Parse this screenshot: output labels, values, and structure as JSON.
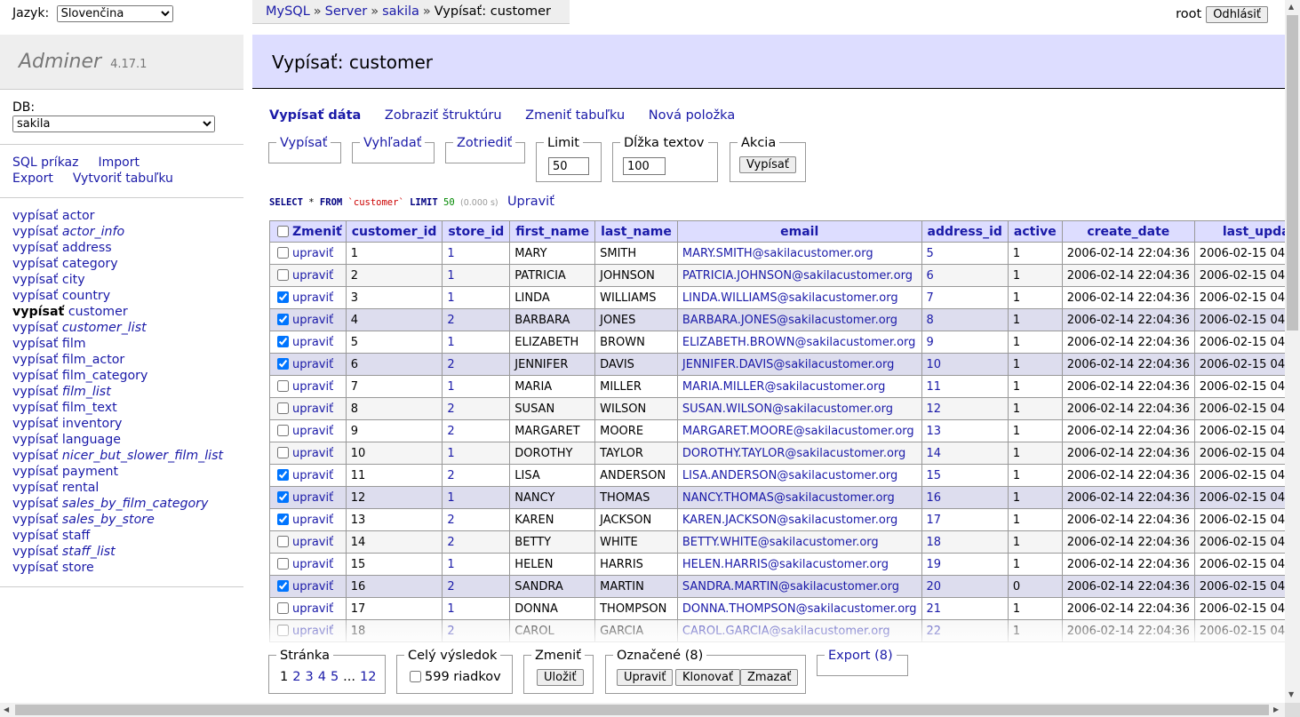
{
  "language": {
    "label": "Jazyk:",
    "value": "Slovenčina"
  },
  "brand": {
    "name": "Adminer",
    "version": "4.17.1"
  },
  "db": {
    "label": "DB:",
    "value": "sakila"
  },
  "links": [
    "SQL príkaz",
    "Import",
    "Export",
    "Vytvoriť tabuľku"
  ],
  "tables": [
    {
      "prefix": "vypísať",
      "name": "actor",
      "italic": false
    },
    {
      "prefix": "vypísať",
      "name": "actor_info",
      "italic": true
    },
    {
      "prefix": "vypísať",
      "name": "address",
      "italic": false
    },
    {
      "prefix": "vypísať",
      "name": "category",
      "italic": false
    },
    {
      "prefix": "vypísať",
      "name": "city",
      "italic": false
    },
    {
      "prefix": "vypísať",
      "name": "country",
      "italic": false
    },
    {
      "prefix": "vypísať",
      "name": "customer",
      "italic": false,
      "current": true
    },
    {
      "prefix": "vypísať",
      "name": "customer_list",
      "italic": true
    },
    {
      "prefix": "vypísať",
      "name": "film",
      "italic": false
    },
    {
      "prefix": "vypísať",
      "name": "film_actor",
      "italic": false
    },
    {
      "prefix": "vypísať",
      "name": "film_category",
      "italic": false
    },
    {
      "prefix": "vypísať",
      "name": "film_list",
      "italic": true
    },
    {
      "prefix": "vypísať",
      "name": "film_text",
      "italic": false
    },
    {
      "prefix": "vypísať",
      "name": "inventory",
      "italic": false
    },
    {
      "prefix": "vypísať",
      "name": "language",
      "italic": false
    },
    {
      "prefix": "vypísať",
      "name": "nicer_but_slower_film_list",
      "italic": true
    },
    {
      "prefix": "vypísať",
      "name": "payment",
      "italic": false
    },
    {
      "prefix": "vypísať",
      "name": "rental",
      "italic": false
    },
    {
      "prefix": "vypísať",
      "name": "sales_by_film_category",
      "italic": true
    },
    {
      "prefix": "vypísať",
      "name": "sales_by_store",
      "italic": true
    },
    {
      "prefix": "vypísať",
      "name": "staff",
      "italic": false
    },
    {
      "prefix": "vypísať",
      "name": "staff_list",
      "italic": true
    },
    {
      "prefix": "vypísať",
      "name": "store",
      "italic": false
    }
  ],
  "breadcrumb": {
    "items": [
      "MySQL",
      "Server",
      "sakila"
    ],
    "sep": "»",
    "current": "Vypísať: customer"
  },
  "user": {
    "name": "root",
    "logout": "Odhlásiť"
  },
  "heading": "Vypísať: customer",
  "tabs": [
    "Vypísať dáta",
    "Zobraziť štruktúru",
    "Zmeniť tabuľku",
    "Nová položka"
  ],
  "controls": {
    "select": "Vypísať",
    "search": "Vyhľadať",
    "sort": "Zotriediť",
    "limit_label": "Limit",
    "limit_value": "50",
    "textlen_label": "Dĺžka textov",
    "textlen_value": "100",
    "action_label": "Akcia",
    "action_button": "Vypísať"
  },
  "query": {
    "select": "SELECT",
    "star": "*",
    "from": "FROM",
    "table": "`customer`",
    "limit": "LIMIT",
    "limit_val": "50",
    "time": "(0.000 s)",
    "edit": "Upraviť"
  },
  "table": {
    "edit_header": "Zmeniť",
    "edit_link": "upraviť",
    "columns": [
      "customer_id",
      "store_id",
      "first_name",
      "last_name",
      "email",
      "address_id",
      "active",
      "create_date",
      "last_upda"
    ],
    "rows": [
      {
        "checked": false,
        "cells": [
          "1",
          "1",
          "MARY",
          "SMITH",
          "MARY.SMITH@sakilacustomer.org",
          "5",
          "1",
          "2006-02-14 22:04:36",
          "2006-02-15 04"
        ]
      },
      {
        "checked": false,
        "cells": [
          "2",
          "1",
          "PATRICIA",
          "JOHNSON",
          "PATRICIA.JOHNSON@sakilacustomer.org",
          "6",
          "1",
          "2006-02-14 22:04:36",
          "2006-02-15 04"
        ]
      },
      {
        "checked": true,
        "cells": [
          "3",
          "1",
          "LINDA",
          "WILLIAMS",
          "LINDA.WILLIAMS@sakilacustomer.org",
          "7",
          "1",
          "2006-02-14 22:04:36",
          "2006-02-15 04"
        ]
      },
      {
        "checked": true,
        "cells": [
          "4",
          "2",
          "BARBARA",
          "JONES",
          "BARBARA.JONES@sakilacustomer.org",
          "8",
          "1",
          "2006-02-14 22:04:36",
          "2006-02-15 04"
        ]
      },
      {
        "checked": true,
        "cells": [
          "5",
          "1",
          "ELIZABETH",
          "BROWN",
          "ELIZABETH.BROWN@sakilacustomer.org",
          "9",
          "1",
          "2006-02-14 22:04:36",
          "2006-02-15 04"
        ]
      },
      {
        "checked": true,
        "cells": [
          "6",
          "2",
          "JENNIFER",
          "DAVIS",
          "JENNIFER.DAVIS@sakilacustomer.org",
          "10",
          "1",
          "2006-02-14 22:04:36",
          "2006-02-15 04"
        ]
      },
      {
        "checked": false,
        "cells": [
          "7",
          "1",
          "MARIA",
          "MILLER",
          "MARIA.MILLER@sakilacustomer.org",
          "11",
          "1",
          "2006-02-14 22:04:36",
          "2006-02-15 04"
        ]
      },
      {
        "checked": false,
        "cells": [
          "8",
          "2",
          "SUSAN",
          "WILSON",
          "SUSAN.WILSON@sakilacustomer.org",
          "12",
          "1",
          "2006-02-14 22:04:36",
          "2006-02-15 04"
        ]
      },
      {
        "checked": false,
        "cells": [
          "9",
          "2",
          "MARGARET",
          "MOORE",
          "MARGARET.MOORE@sakilacustomer.org",
          "13",
          "1",
          "2006-02-14 22:04:36",
          "2006-02-15 04"
        ]
      },
      {
        "checked": false,
        "cells": [
          "10",
          "1",
          "DOROTHY",
          "TAYLOR",
          "DOROTHY.TAYLOR@sakilacustomer.org",
          "14",
          "1",
          "2006-02-14 22:04:36",
          "2006-02-15 04"
        ]
      },
      {
        "checked": true,
        "cells": [
          "11",
          "2",
          "LISA",
          "ANDERSON",
          "LISA.ANDERSON@sakilacustomer.org",
          "15",
          "1",
          "2006-02-14 22:04:36",
          "2006-02-15 04"
        ]
      },
      {
        "checked": true,
        "cells": [
          "12",
          "1",
          "NANCY",
          "THOMAS",
          "NANCY.THOMAS@sakilacustomer.org",
          "16",
          "1",
          "2006-02-14 22:04:36",
          "2006-02-15 04"
        ]
      },
      {
        "checked": true,
        "cells": [
          "13",
          "2",
          "KAREN",
          "JACKSON",
          "KAREN.JACKSON@sakilacustomer.org",
          "17",
          "1",
          "2006-02-14 22:04:36",
          "2006-02-15 04"
        ]
      },
      {
        "checked": false,
        "cells": [
          "14",
          "2",
          "BETTY",
          "WHITE",
          "BETTY.WHITE@sakilacustomer.org",
          "18",
          "1",
          "2006-02-14 22:04:36",
          "2006-02-15 04"
        ]
      },
      {
        "checked": false,
        "cells": [
          "15",
          "1",
          "HELEN",
          "HARRIS",
          "HELEN.HARRIS@sakilacustomer.org",
          "19",
          "1",
          "2006-02-14 22:04:36",
          "2006-02-15 04"
        ]
      },
      {
        "checked": true,
        "cells": [
          "16",
          "2",
          "SANDRA",
          "MARTIN",
          "SANDRA.MARTIN@sakilacustomer.org",
          "20",
          "0",
          "2006-02-14 22:04:36",
          "2006-02-15 04"
        ]
      },
      {
        "checked": false,
        "cells": [
          "17",
          "1",
          "DONNA",
          "THOMPSON",
          "DONNA.THOMPSON@sakilacustomer.org",
          "21",
          "1",
          "2006-02-14 22:04:36",
          "2006-02-15 04"
        ]
      },
      {
        "checked": false,
        "cells": [
          "18",
          "2",
          "CAROL",
          "GARCIA",
          "CAROL.GARCIA@sakilacustomer.org",
          "22",
          "1",
          "2006-02-14 22:04:36",
          "2006-02-15 04"
        ]
      }
    ]
  },
  "footer": {
    "page_label": "Stránka",
    "pages": [
      "1",
      "2",
      "3",
      "4",
      "5",
      "...",
      "12"
    ],
    "whole_label": "Celý výsledok",
    "whole_rows": "599 riadkov",
    "modify_label": "Zmeniť",
    "save_button": "Uložiť",
    "selected_label": "Označené (8)",
    "edit_button": "Upraviť",
    "clone_button": "Klonovať",
    "delete_button": "Zmazať",
    "export_label": "Export (8)"
  }
}
